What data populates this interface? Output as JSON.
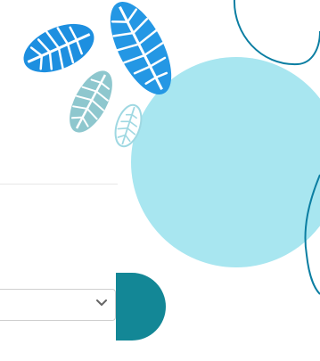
{
  "form": {
    "select_value": "",
    "button_label": ""
  },
  "icons": {
    "chevron": "chevron-down-icon",
    "decor": "leaf-icon"
  },
  "colors": {
    "leaf_dark_blue": "#1d8fe0",
    "leaf_mid_blue": "#2497e4",
    "leaf_light_teal": "#8ec7ce",
    "leaf_outline": "#9fd8e2",
    "bubble": "#a8e6f0",
    "line": "#0b7ea2",
    "button": "#138796"
  }
}
